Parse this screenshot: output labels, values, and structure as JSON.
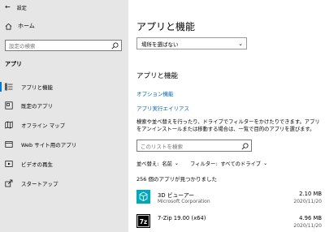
{
  "window": {
    "title": "設定"
  },
  "sidebar": {
    "home_label": "ホーム",
    "search_placeholder": "設定の検索",
    "section_label": "アプリ",
    "items": [
      {
        "label": "アプリと機能",
        "icon": "apps-list-icon",
        "active": true
      },
      {
        "label": "既定のアプリ",
        "icon": "default-apps-icon",
        "active": false
      },
      {
        "label": "オフライン マップ",
        "icon": "offline-map-icon",
        "active": false
      },
      {
        "label": "Web サイト用のアプリ",
        "icon": "website-apps-icon",
        "active": false
      },
      {
        "label": "ビデオの再生",
        "icon": "video-playback-icon",
        "active": false
      },
      {
        "label": "スタートアップ",
        "icon": "startup-icon",
        "active": false
      }
    ]
  },
  "main": {
    "title": "アプリと機能",
    "source_dropdown": "場所を選ばない",
    "subtitle": "アプリと機能",
    "links": {
      "optional_features": "オプション機能",
      "execution_alias": "アプリ実行エイリアス"
    },
    "description": "検索や並べ替えを行ったり、ドライブでフィルターをかけたりできます。アプリをアンインストールまたは移動する場合は、一覧で目的のアプリを選びます。",
    "list_search_placeholder": "このリストを検索",
    "sort": {
      "label": "並べ替え:",
      "value": "名前"
    },
    "filter": {
      "label": "フィルター:",
      "value": "すべてのドライブ"
    },
    "found_text": "256 個のアプリが見つかりました",
    "apps": [
      {
        "name": "3D ビューアー",
        "publisher": "Microsoft Corporation",
        "size": "2.10 MB",
        "date": "2020/11/20",
        "icon": "3d-viewer-icon"
      },
      {
        "name": "7-Zip 19.00 (x64)",
        "publisher": "",
        "size": "4.96 MB",
        "date": "2020/11/20",
        "icon": "7zip-icon"
      }
    ]
  },
  "colors": {
    "accent": "#0078d7",
    "link": "#0063b1",
    "sidebar_bg": "#e6e6e6",
    "viewer_icon": "#00a8b8"
  }
}
